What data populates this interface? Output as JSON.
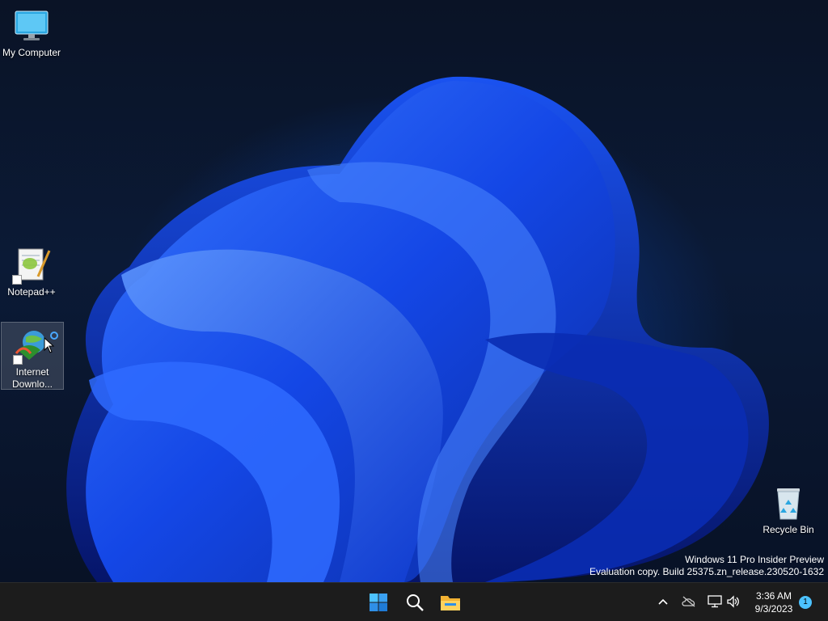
{
  "desktop": {
    "icons": [
      {
        "label": "My Computer"
      },
      {
        "label": "Notepad++"
      },
      {
        "label": "Internet Downlo..."
      },
      {
        "label": "Recycle Bin"
      }
    ],
    "watermark": {
      "line1": "Windows 11 Pro Insider Preview",
      "line2": "Evaluation copy. Build 25375.zn_release.230520-1632"
    }
  },
  "taskbar": {
    "pinned": [
      {
        "name": "start-icon"
      },
      {
        "name": "search-icon"
      },
      {
        "name": "file-explorer-icon"
      }
    ],
    "tray": {
      "time": "3:36 AM",
      "date": "9/3/2023",
      "notification_count": "1"
    }
  },
  "colors": {
    "accent": "#0a5cff",
    "taskbar_bg": "#1c1c1c",
    "badge": "#4cc2ff"
  }
}
